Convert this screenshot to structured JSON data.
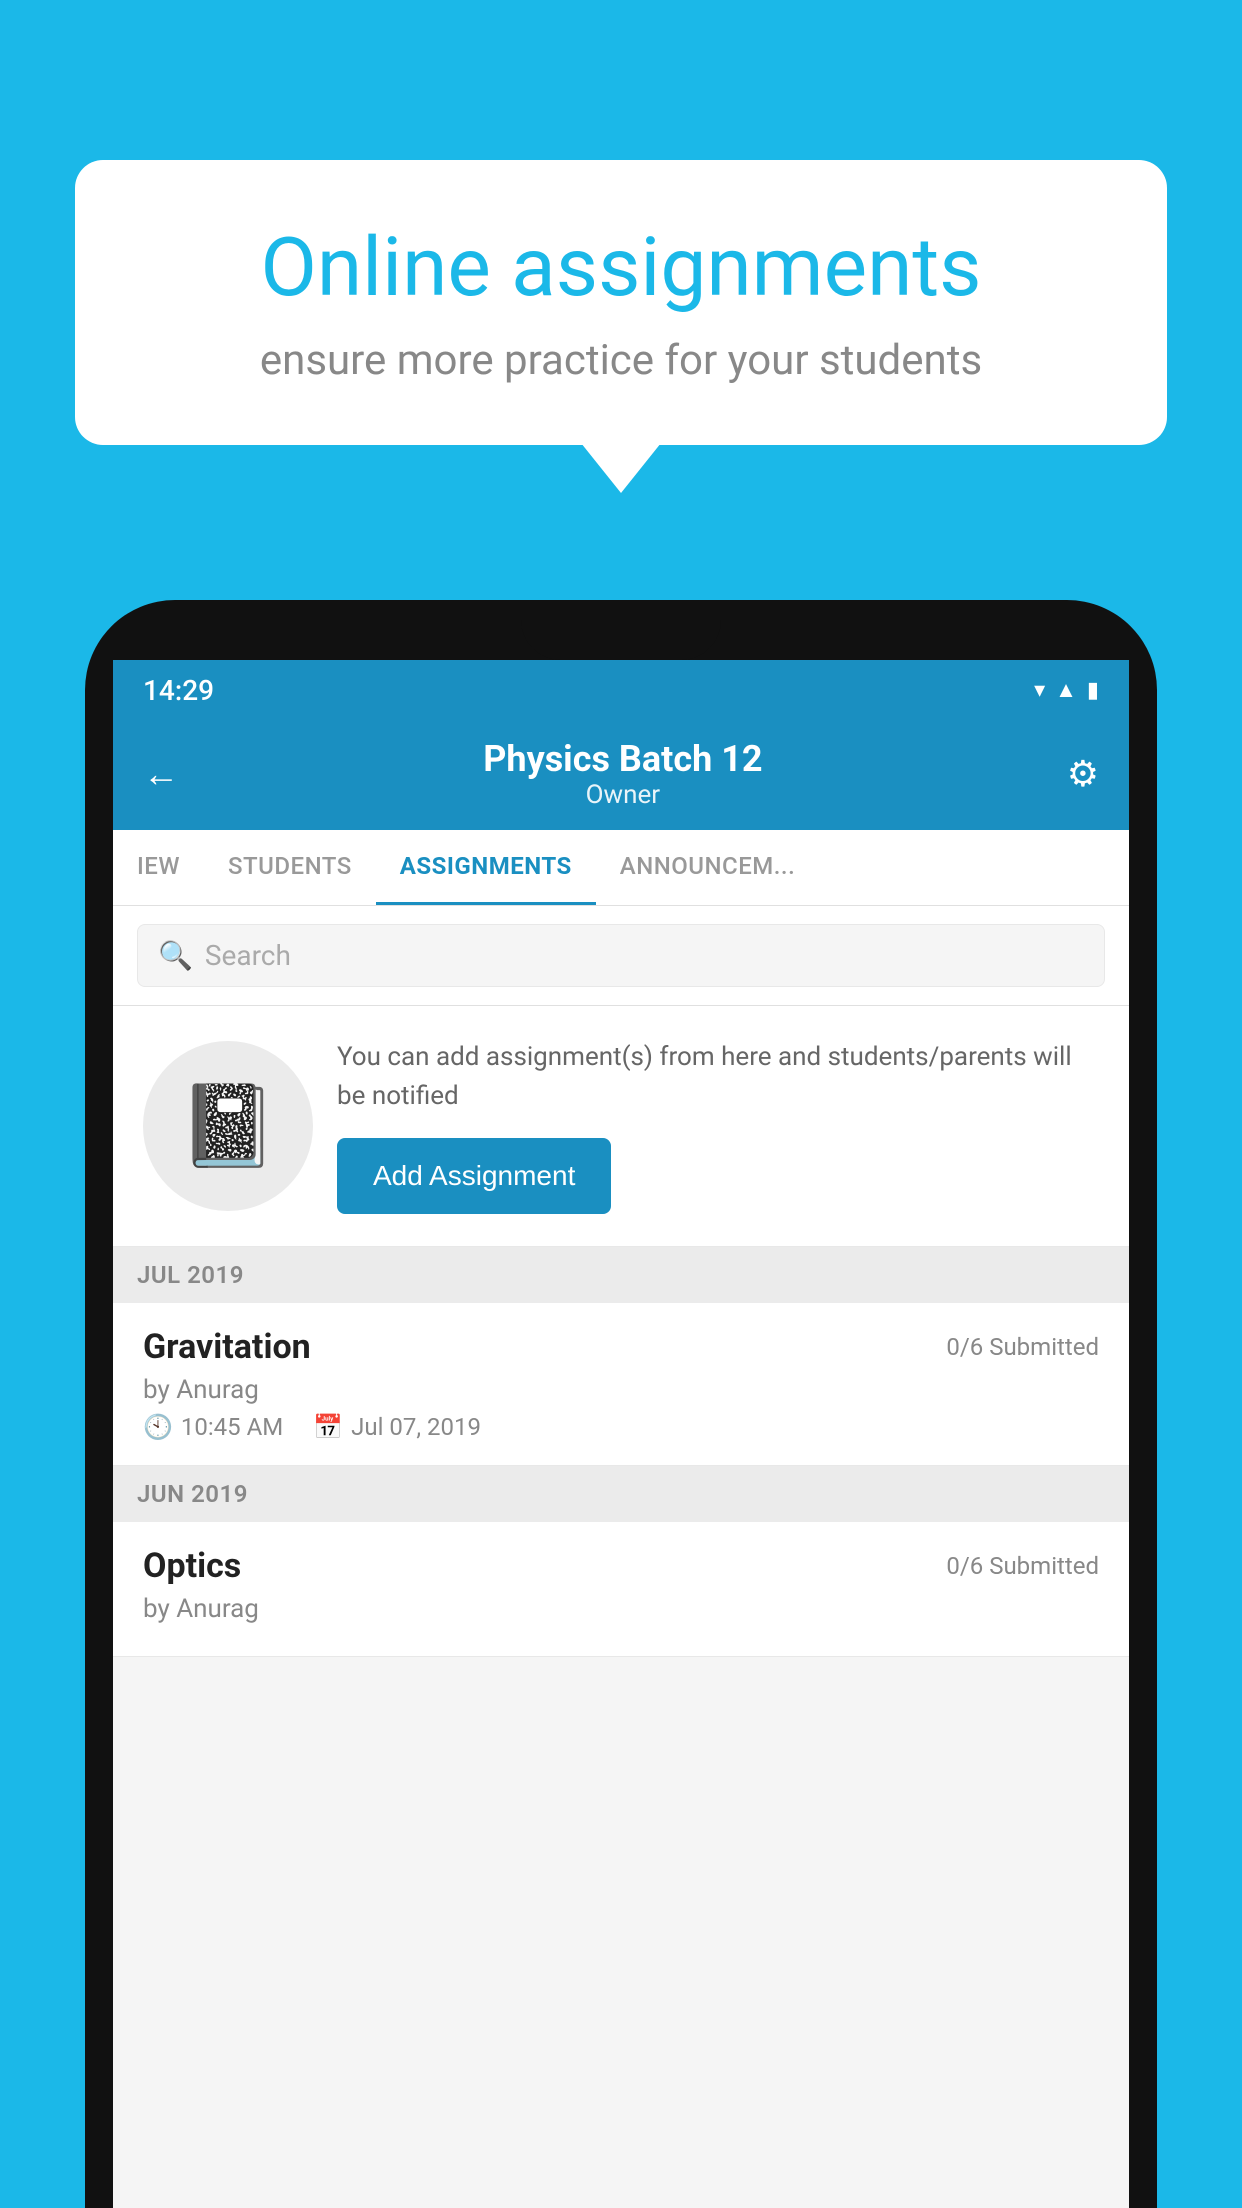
{
  "background": {
    "color": "#1BB8E8"
  },
  "speech_bubble": {
    "title": "Online assignments",
    "subtitle": "ensure more practice for your students"
  },
  "status_bar": {
    "time": "14:29",
    "icons": [
      "wifi",
      "signal",
      "battery"
    ]
  },
  "app_header": {
    "title": "Physics Batch 12",
    "subtitle": "Owner",
    "back_label": "←",
    "gear_label": "⚙"
  },
  "tabs": [
    {
      "label": "IEW",
      "active": false
    },
    {
      "label": "STUDENTS",
      "active": false
    },
    {
      "label": "ASSIGNMENTS",
      "active": true
    },
    {
      "label": "ANNOUNCEM...",
      "active": false
    }
  ],
  "search": {
    "placeholder": "Search"
  },
  "promo_card": {
    "text": "You can add assignment(s) from here and students/parents will be notified",
    "button_label": "Add Assignment"
  },
  "sections": [
    {
      "header": "JUL 2019",
      "items": [
        {
          "name": "Gravitation",
          "submitted": "0/6 Submitted",
          "author": "by Anurag",
          "time": "10:45 AM",
          "date": "Jul 07, 2019"
        }
      ]
    },
    {
      "header": "JUN 2019",
      "items": [
        {
          "name": "Optics",
          "submitted": "0/6 Submitted",
          "author": "by Anurag",
          "time": "",
          "date": ""
        }
      ]
    }
  ]
}
